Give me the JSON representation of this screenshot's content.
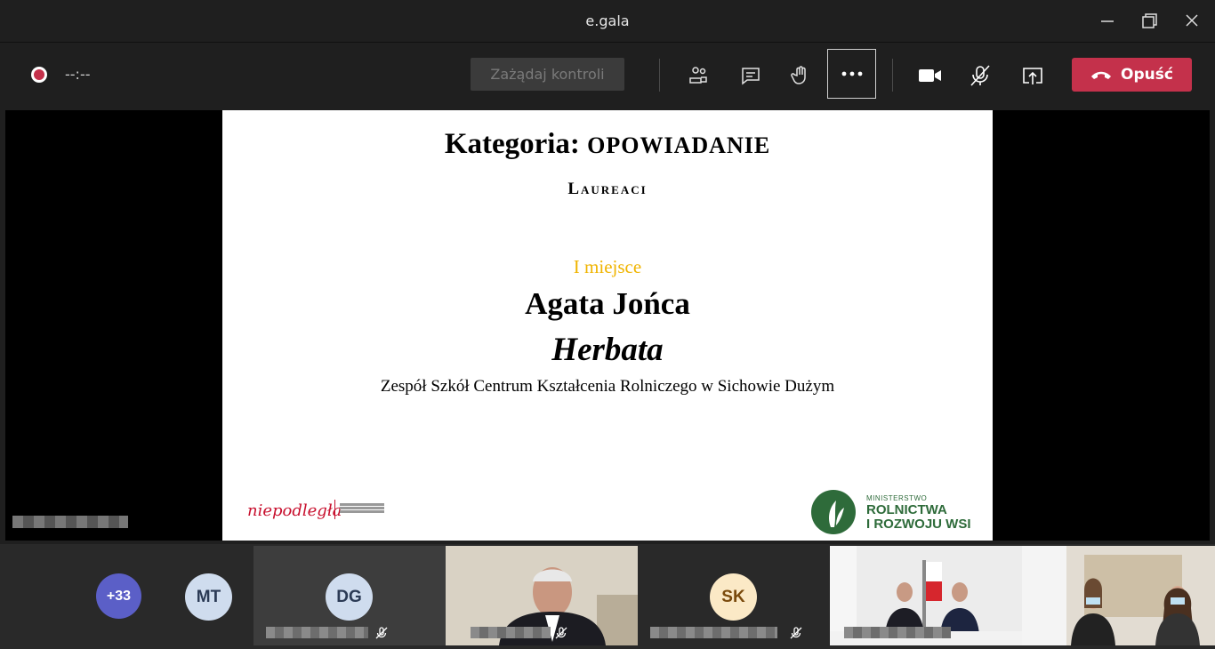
{
  "window": {
    "title": "e.gala"
  },
  "toolbar": {
    "timer": "--:--",
    "request_control_label": "Zażądaj kontroli",
    "leave_label": "Opuść",
    "leave_color": "#c4314b"
  },
  "slide": {
    "category_prefix": "Kategoria:",
    "category_value": "OPOWIADANIE",
    "laureates": "Laureaci",
    "place": "I miejsce",
    "winner_name": "Agata Jońca",
    "work_title": "Herbata",
    "school": "Zespół Szkół Centrum Kształcenia Rolniczego w Sichowie Dużym",
    "logo_left_text": "niepodległa",
    "logo_right_small": "MINISTERSTWO",
    "logo_right_line1": "ROLNICTWA",
    "logo_right_line2": "I ROZWOJU WSI"
  },
  "participants": {
    "overflow_count": "+33",
    "initials": [
      "MT",
      "DG",
      "SK"
    ]
  }
}
